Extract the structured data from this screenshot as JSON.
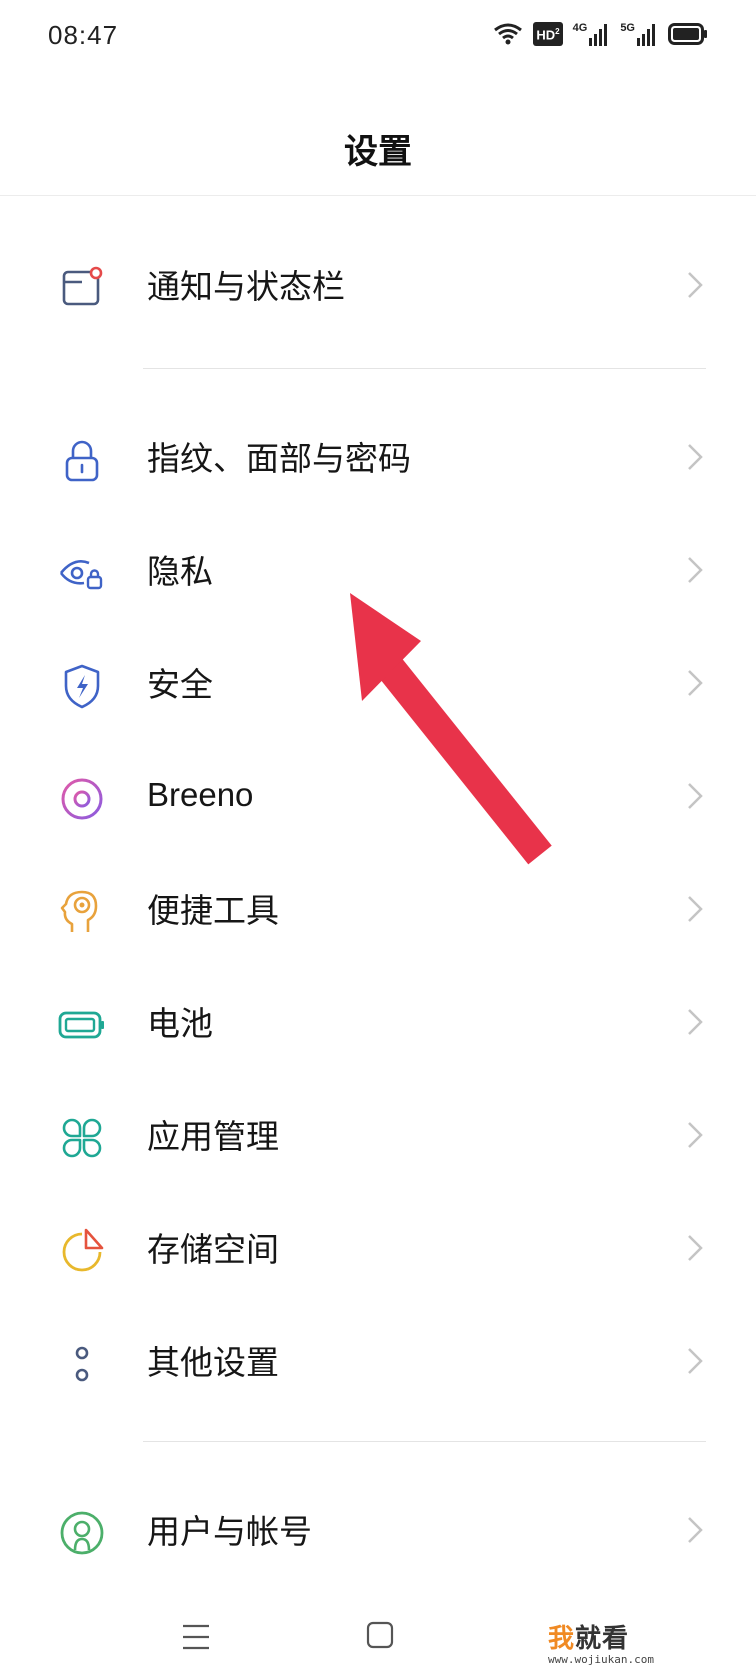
{
  "status_bar": {
    "time": "08:47",
    "hd_badge": "HD",
    "hd_sup": "2",
    "net1": "4G",
    "net2": "5G"
  },
  "header": {
    "title": "设置"
  },
  "items": [
    {
      "label": "通知与状态栏",
      "icon": "notification-icon"
    },
    {
      "label": "指纹、面部与密码",
      "icon": "lock-icon"
    },
    {
      "label": "隐私",
      "icon": "privacy-eye-icon"
    },
    {
      "label": "安全",
      "icon": "shield-icon"
    },
    {
      "label": "Breeno",
      "icon": "breeno-icon"
    },
    {
      "label": "便捷工具",
      "icon": "convenience-tools-icon"
    },
    {
      "label": "电池",
      "icon": "battery-icon"
    },
    {
      "label": "应用管理",
      "icon": "app-management-icon"
    },
    {
      "label": "存储空间",
      "icon": "storage-icon"
    },
    {
      "label": "其他设置",
      "icon": "other-settings-icon"
    },
    {
      "label": "用户与帐号",
      "icon": "user-account-icon"
    }
  ],
  "annotation": {
    "arrow_color": "#e8334a"
  },
  "watermark": {
    "accent": "我",
    "main": "就看",
    "url": "www.wojiukan.com"
  },
  "colors": {
    "chevron": "#c4c4c4",
    "divider": "#e4e4e4"
  }
}
